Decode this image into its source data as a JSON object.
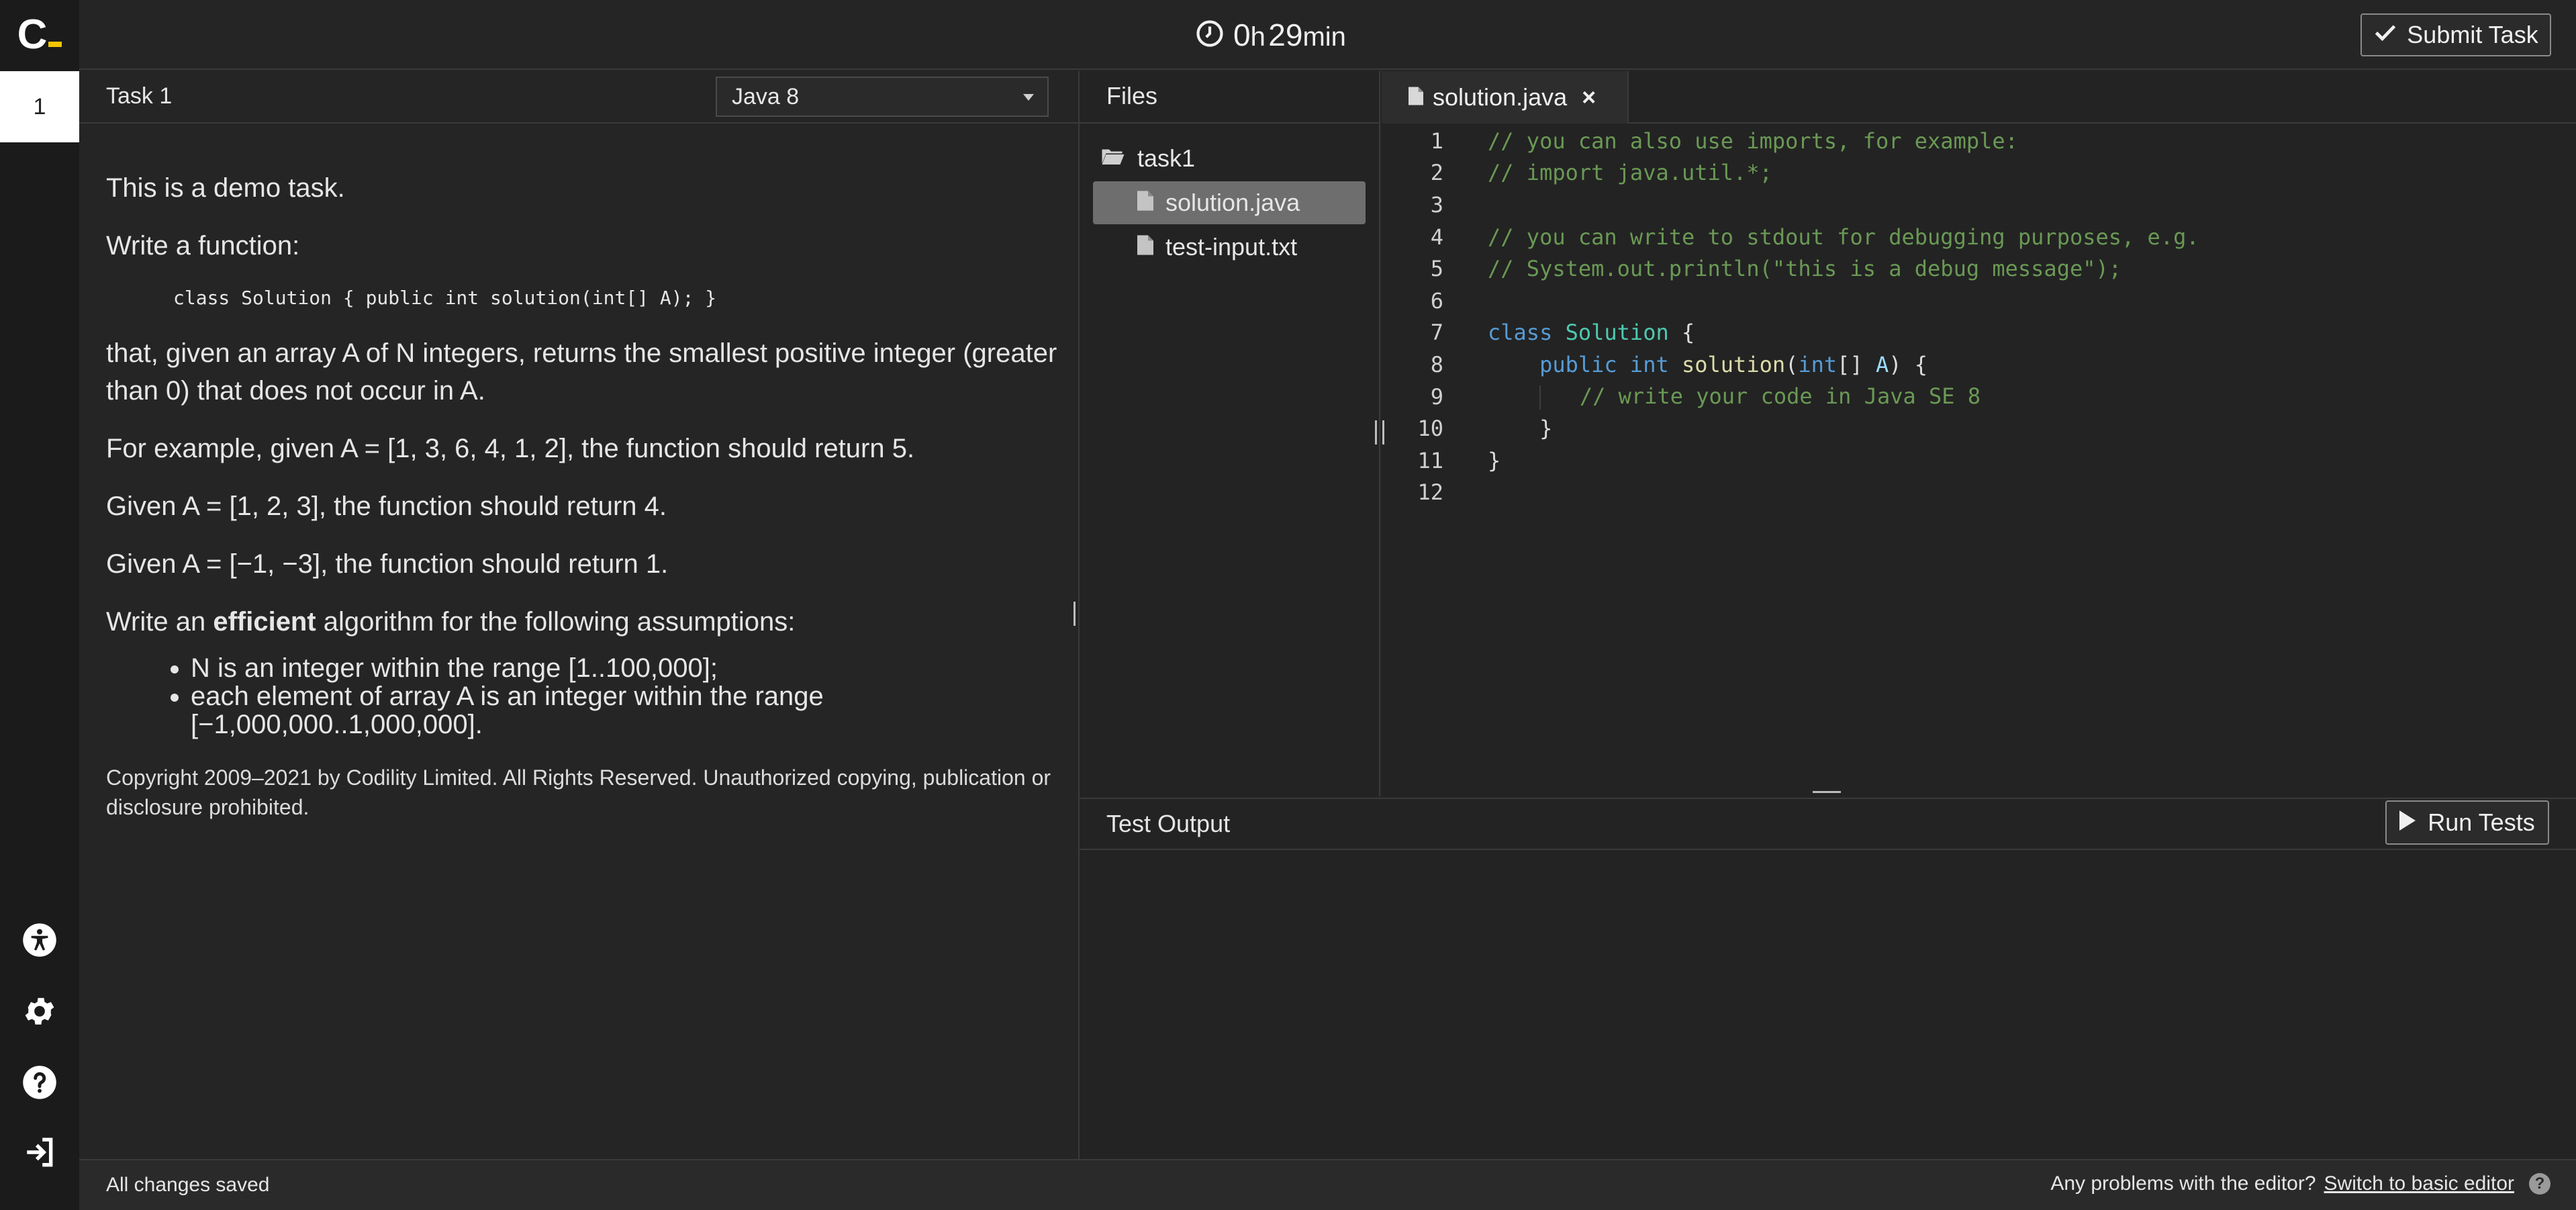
{
  "logo": {
    "letter": "C"
  },
  "sidebar": {
    "task_number": "1"
  },
  "timer": {
    "hours": "0",
    "hours_unit": "h",
    "minutes": "29",
    "minutes_unit": "min"
  },
  "toolbar": {
    "submit_label": "Submit Task"
  },
  "task": {
    "title": "Task 1",
    "language": "Java 8",
    "intro": "This is a demo task.",
    "write_function": "Write a function:",
    "signature": "class Solution { public int solution(int[] A); }",
    "description": "that, given an array A of N integers, returns the smallest positive integer (greater than 0) that does not occur in A.",
    "example1": "For example, given A = [1, 3, 6, 4, 1, 2], the function should return 5.",
    "example2": "Given A = [1, 2, 3], the function should return 4.",
    "example3": "Given A = [−1, −3], the function should return 1.",
    "assumptions_prefix": "Write an ",
    "assumptions_bold": "efficient",
    "assumptions_suffix": " algorithm for the following assumptions:",
    "assumptions": [
      "N is an integer within the range [1..100,000];",
      "each element of array A is an integer within the range [−1,000,000..1,000,000]."
    ],
    "copyright": "Copyright 2009–2021 by Codility Limited. All Rights Reserved. Unauthorized copying, publication or disclosure prohibited."
  },
  "files": {
    "header": "Files",
    "folder": "task1",
    "items": [
      "solution.java",
      "test-input.txt"
    ],
    "selected": "solution.java"
  },
  "editor": {
    "tab_label": "solution.java",
    "close_glyph": "×",
    "line_numbers": [
      "1",
      "2",
      "3",
      "4",
      "5",
      "6",
      "7",
      "8",
      "9",
      "10",
      "11",
      "12"
    ],
    "code": {
      "l1": "// you can also use imports, for example:",
      "l2": "// import java.util.*;",
      "l4": "// you can write to stdout for debugging purposes, e.g.",
      "l5": "// System.out.println(\"this is a debug message\");",
      "l7_kw": "class",
      "l7_cls": "Solution",
      "l7_rest": " {",
      "l8_kw1": "public",
      "l8_kw2": "int",
      "l8_fn": "solution",
      "l8_p1": "(",
      "l8_kw3": "int",
      "l8_p2": "[] ",
      "l8_var": "A",
      "l8_p3": ") {",
      "l9": "// write your code in Java SE 8",
      "l10": "}",
      "l11": "}"
    }
  },
  "output": {
    "title": "Test Output",
    "run_label": "Run Tests"
  },
  "status": {
    "saved": "All changes saved",
    "problems": "Any problems with the editor?",
    "switch_link": "Switch to basic editor",
    "help": "?"
  },
  "colors": {
    "accent": "#f2c500",
    "background": "#252525",
    "sidebar": "#1b1b1b",
    "comment": "#6a9955",
    "keyword": "#569cd6",
    "class": "#4ec9b0",
    "function": "#dcdcaa"
  },
  "icons": [
    "clock-icon",
    "check-icon",
    "accessibility-icon",
    "gear-icon",
    "help-icon",
    "sign-in-icon",
    "folder-open-icon",
    "file-icon",
    "close-icon",
    "play-icon",
    "chevron-down-icon"
  ]
}
